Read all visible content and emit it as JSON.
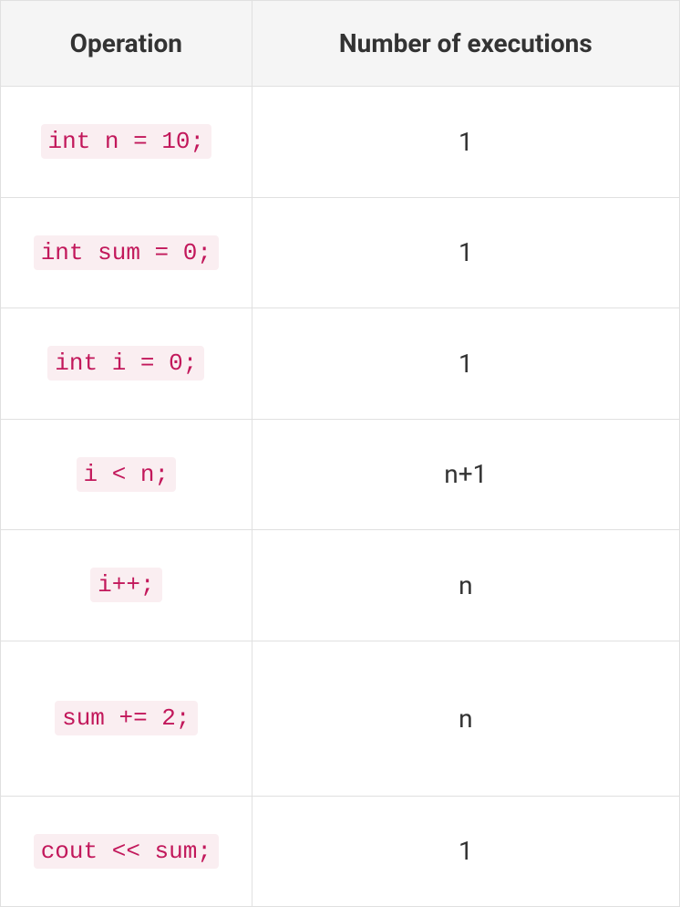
{
  "headers": {
    "operation": "Operation",
    "executions": "Number of executions"
  },
  "rows": [
    {
      "operation": "int n = 10;",
      "executions": "1"
    },
    {
      "operation": "int sum = 0;",
      "executions": "1"
    },
    {
      "operation": "int i = 0;",
      "executions": "1"
    },
    {
      "operation": "i < n;",
      "executions": "n+1"
    },
    {
      "operation": "i++;",
      "executions": "n"
    },
    {
      "operation": "sum += 2;",
      "executions": "n"
    },
    {
      "operation": "cout << sum;",
      "executions": "1"
    }
  ],
  "chart_data": {
    "type": "table",
    "columns": [
      "Operation",
      "Number of executions"
    ],
    "rows": [
      [
        "int n = 10;",
        "1"
      ],
      [
        "int sum = 0;",
        "1"
      ],
      [
        "int i = 0;",
        "1"
      ],
      [
        "i < n;",
        "n+1"
      ],
      [
        "i++;",
        "n"
      ],
      [
        "sum += 2;",
        "n"
      ],
      [
        "cout << sum;",
        "1"
      ]
    ]
  }
}
